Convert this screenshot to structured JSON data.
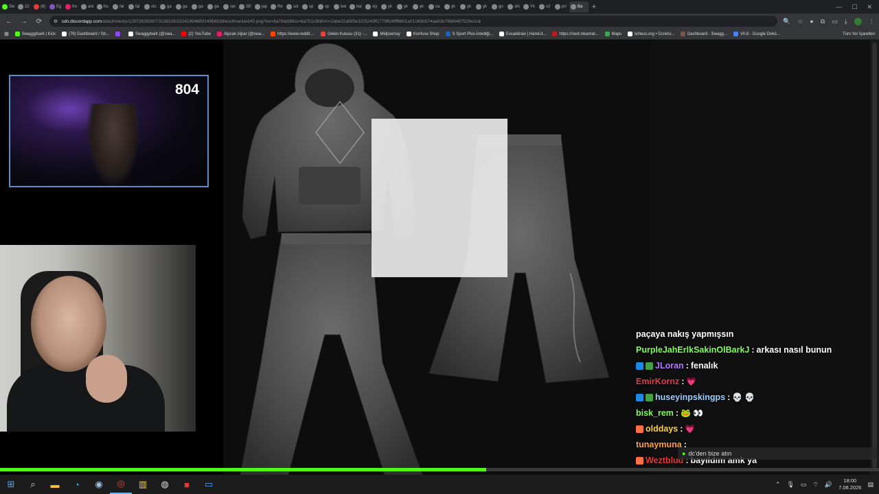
{
  "browser": {
    "tabs": [
      {
        "label": "Sw",
        "color": "#53fc18"
      },
      {
        "label": "22",
        "color": "#888888"
      },
      {
        "label": "(8)",
        "color": "#e53935"
      },
      {
        "label": "Eg",
        "color": "#7e57c2"
      },
      {
        "label": "fro",
        "color": "#e91e63"
      },
      {
        "label": "ark",
        "color": "#888888"
      },
      {
        "label": "hu",
        "color": "#888888"
      },
      {
        "label": "fal",
        "color": "#888888"
      },
      {
        "label": "fal",
        "color": "#888888"
      },
      {
        "label": "stc",
        "color": "#888888"
      },
      {
        "label": "ga",
        "color": "#888888"
      },
      {
        "label": "ga",
        "color": "#888888"
      },
      {
        "label": "ga",
        "color": "#888888"
      },
      {
        "label": "ga",
        "color": "#888888"
      },
      {
        "label": "ser",
        "color": "#888888"
      },
      {
        "label": "SE",
        "color": "#888888"
      },
      {
        "label": "jap",
        "color": "#888888"
      },
      {
        "label": "Re",
        "color": "#888888"
      },
      {
        "label": "sık",
        "color": "#888888"
      },
      {
        "label": "sp",
        "color": "#888888"
      },
      {
        "label": "sp",
        "color": "#888888"
      },
      {
        "label": "ber",
        "color": "#888888"
      },
      {
        "label": "kal",
        "color": "#888888"
      },
      {
        "label": "siy",
        "color": "#888888"
      },
      {
        "label": "yk",
        "color": "#888888"
      },
      {
        "label": "yk",
        "color": "#888888"
      },
      {
        "label": "yk",
        "color": "#888888"
      },
      {
        "label": "ca",
        "color": "#888888"
      },
      {
        "label": "yk",
        "color": "#888888"
      },
      {
        "label": "yk",
        "color": "#888888"
      },
      {
        "label": "yk",
        "color": "#888888"
      },
      {
        "label": "go",
        "color": "#888888"
      },
      {
        "label": "shi",
        "color": "#888888"
      },
      {
        "label": "Yk",
        "color": "#888888"
      },
      {
        "label": "v2",
        "color": "#888888"
      },
      {
        "label": "pri",
        "color": "#888888"
      },
      {
        "label": "Ba",
        "color": "#888888"
      }
    ],
    "new_tab": "+",
    "url_host": "cdn.discordapp.com",
    "url_path": "/attachments/1297282816073138226/1524199468914966538/esofmanlar645.png?ex=6a766ddf&is=6a751c5f&hm=2abe32a505e1f25240ff1779ffd4fff8601a01265b574aa03b7f666487529e2c&",
    "bookmarks": [
      {
        "label": "Swaggybark | Kick",
        "color": "#53fc18"
      },
      {
        "label": "(79) Dashboard / Str...",
        "color": "#ffffff"
      },
      {
        "label": "",
        "color": "#9146ff"
      },
      {
        "label": "Swaggybark (@swa...",
        "color": "#ffffff"
      },
      {
        "label": "(2) YouTube",
        "color": "#ff0000"
      },
      {
        "label": "Alpcan Alpar (@swa...",
        "color": "#e91e63"
      },
      {
        "label": "https://www.reddit....",
        "color": "#ff4500"
      },
      {
        "label": "Gelen Kutusu (31) -...",
        "color": "#ea4335"
      },
      {
        "label": "Midjourney",
        "color": "#ffffff"
      },
      {
        "label": "Konfuse Shop",
        "color": "#ffffff"
      },
      {
        "label": "S Sport Plus-İstediği...",
        "color": "#1565c0"
      },
      {
        "label": "Excalidraw | Hand-d...",
        "color": "#ffffff"
      },
      {
        "label": "https://next.inkamat...",
        "color": "#b71c1c"
      },
      {
        "label": "Maps",
        "color": "#34a853"
      },
      {
        "label": "lichess.org • Ücretsi...",
        "color": "#ffffff"
      },
      {
        "label": "Dashboard - Swagg...",
        "color": "#795548"
      },
      {
        "label": "V0.8 - Google Dokü...",
        "color": "#4285f4"
      }
    ],
    "all_bookmarks": "Tüm Yer İşaretleri"
  },
  "stream": {
    "cam_count": "804",
    "progress_fraction": 0.553
  },
  "chat": {
    "messages": [
      {
        "user": "",
        "user_color": "#ffffff",
        "text": "paçaya nakış yapmışsın",
        "badges": [],
        "emotes": []
      },
      {
        "user": "PurpleJahErlkSakinOlBarkJ",
        "user_color": "#7fff5a",
        "text": "arkası nasıl bunun",
        "badges": [],
        "emotes": []
      },
      {
        "user": "JLoran",
        "user_color": "#b678ff",
        "text": "fenalık",
        "badges": [
          "#1e88e5",
          "#43a047"
        ],
        "emotes": []
      },
      {
        "user": "EmirKornz",
        "user_color": "#e53945",
        "text": "",
        "badges": [],
        "emotes": [
          "💗"
        ]
      },
      {
        "user": "huseyinpskingps",
        "user_color": "#9ccfff",
        "text": "",
        "badges": [
          "#1e88e5",
          "#43a047"
        ],
        "emotes": [
          "💀",
          "💀"
        ]
      },
      {
        "user": "bisk_rem",
        "user_color": "#7fff5a",
        "text": "",
        "badges": [],
        "emotes": [
          "🐸",
          "👀"
        ]
      },
      {
        "user": "olddays",
        "user_color": "#ffd24c",
        "text": "",
        "badges": [
          "#ff7043"
        ],
        "emotes": [
          "💗"
        ]
      },
      {
        "user": "tunaymuna",
        "user_color": "#ff9f43",
        "text": "",
        "badges": [],
        "emotes": []
      },
      {
        "user": "Weztblud",
        "user_color": "#e53935",
        "text": "bayıldım amk ya",
        "badges": [
          "#ff7043"
        ],
        "emotes": []
      }
    ],
    "popup_text": "dc'den bize atın"
  },
  "taskbar": {
    "time": "18:00",
    "date": "7.08.2026"
  }
}
